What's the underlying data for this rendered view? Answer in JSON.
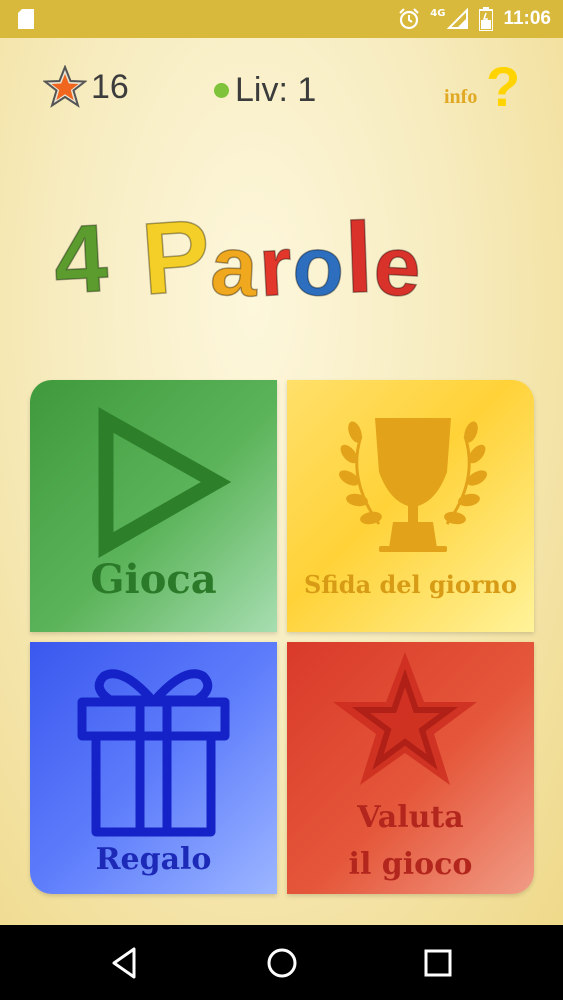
{
  "status_bar": {
    "time": "11:06",
    "network": "4G",
    "icons": [
      "sd-card-icon",
      "alarm-icon",
      "signal-icon",
      "battery-icon"
    ]
  },
  "header": {
    "stars_count": "16",
    "level_text": "Liv: 1",
    "info_label": "info",
    "info_mark": "?"
  },
  "logo": {
    "letters": [
      "4",
      "P",
      "a",
      "r",
      "o",
      "l",
      "e"
    ],
    "colors": [
      "#5c9c2e",
      "#f4cf28",
      "#f0a81e",
      "#e2372a",
      "#2d6fbe",
      "#d9322a",
      "#d9322a"
    ]
  },
  "tiles": {
    "gioca": {
      "label": "Gioca",
      "icon": "play-icon",
      "color": "#4aa548"
    },
    "sfida": {
      "label": "Sfida del giorno",
      "icon": "trophy-icon",
      "color": "#ffd738"
    },
    "regalo": {
      "label": "Regalo",
      "icon": "gift-icon",
      "color": "#4c6cf5"
    },
    "valuta": {
      "label_line1": "Valuta",
      "label_line2": "il gioco",
      "icon": "star-icon",
      "color": "#e04a35"
    }
  },
  "nav_bar": {
    "icons": [
      "back-icon",
      "home-icon",
      "recents-icon"
    ]
  }
}
